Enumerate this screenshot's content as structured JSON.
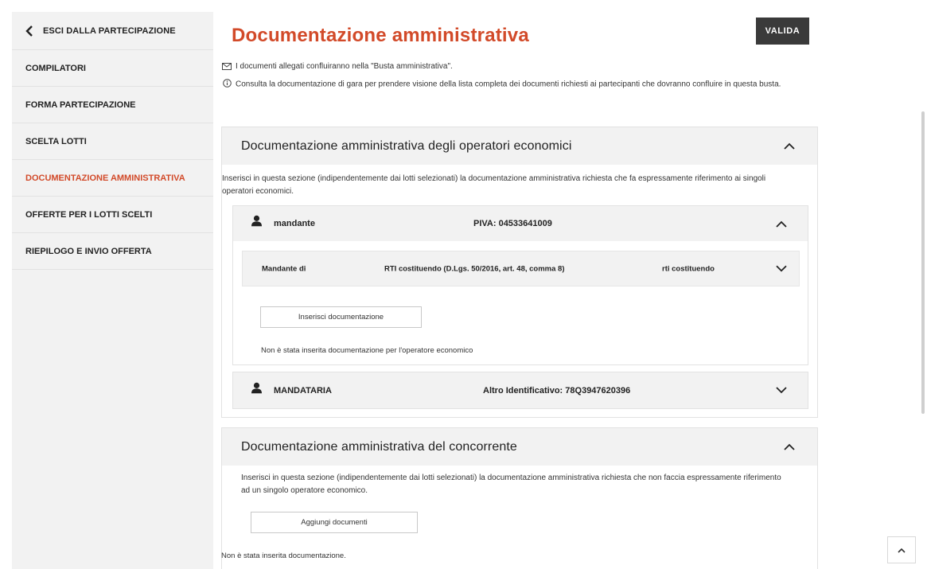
{
  "sidebar": {
    "back_label": "ESCI DALLA PARTECIPAZIONE",
    "items": [
      {
        "label": "COMPILATORI",
        "active": false
      },
      {
        "label": "FORMA PARTECIPAZIONE",
        "active": false
      },
      {
        "label": "SCELTA LOTTI",
        "active": false
      },
      {
        "label": "DOCUMENTAZIONE AMMINISTRATIVA",
        "active": true
      },
      {
        "label": "OFFERTE PER I LOTTI SCELTI",
        "active": false
      },
      {
        "label": "RIEPILOGO E INVIO OFFERTA",
        "active": false
      }
    ]
  },
  "header": {
    "title": "Documentazione amministrativa",
    "valida_label": "VALIDA",
    "info_envelope": "I documenti allegati confluiranno nella \"Busta amministrativa\".",
    "info_consult": "Consulta la documentazione di gara per prendere visione della lista completa dei documenti richiesti ai partecipanti che dovranno confluire in questa busta."
  },
  "section_operators": {
    "title": "Documentazione amministrativa degli operatori economici",
    "description": "Inserisci in questa sezione (indipendentemente dai lotti selezionati) la documentazione amministrativa richiesta che fa espressamente riferimento ai singoli operatori economici.",
    "mandante": {
      "name": "mandante",
      "id_text": "PIVA: 04533641009",
      "sub": {
        "label": "Mandante di",
        "type": "RTI costituendo (D.Lgs. 50/2016, art. 48, comma 8)",
        "status": "rti costituendo"
      },
      "insert_button": "Inserisci documentazione",
      "empty_note": "Non è stata inserita documentazione per l'operatore economico"
    },
    "mandataria": {
      "name": "MANDATARIA",
      "id_text": "Altro Identificativo: 78Q3947620396"
    }
  },
  "section_concorrente": {
    "title": "Documentazione amministrativa del concorrente",
    "description": "Inserisci in questa sezione (indipendentemente dai lotti selezionati) la documentazione amministrativa richiesta che non faccia espressamente riferimento ad un singolo operatore economico.",
    "add_button": "Aggiungi documenti",
    "empty_note": "Non è stata inserita documentazione."
  },
  "icons": {
    "back": "chevron-left-icon",
    "envelope": "envelope-icon",
    "info": "info-circle-icon",
    "person": "user-icon",
    "collapse": "chevron-up-icon",
    "expand": "chevron-down-icon",
    "scroll_top": "arrow-up-icon"
  },
  "colors": {
    "accent": "#d24a29",
    "primary_button": "#3a3a3a",
    "panel_bg": "#f2f2f2"
  }
}
